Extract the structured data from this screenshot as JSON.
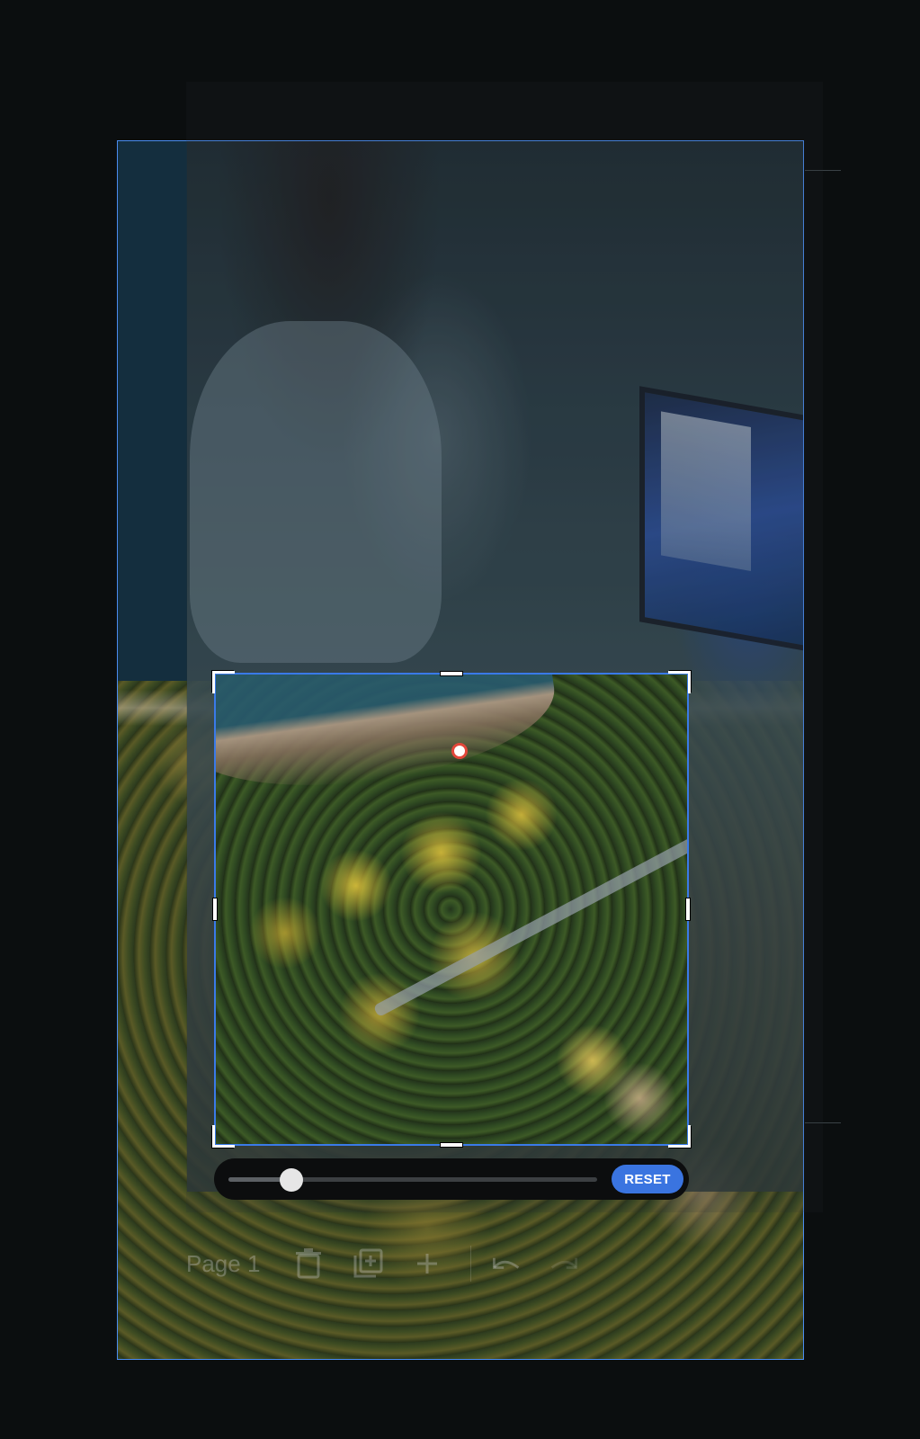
{
  "zoom": {
    "value": 0.17,
    "reset_label": "RESET"
  },
  "toolbar": {
    "page_label": "Page 1",
    "icons": [
      "delete-icon",
      "duplicate-page-icon",
      "add-page-icon",
      "undo-icon",
      "redo-icon"
    ]
  },
  "colors": {
    "accent": "#3a74e0",
    "selection": "#4a8cf0",
    "focal_point": "#e2463a",
    "background": "#0b0e0f"
  }
}
